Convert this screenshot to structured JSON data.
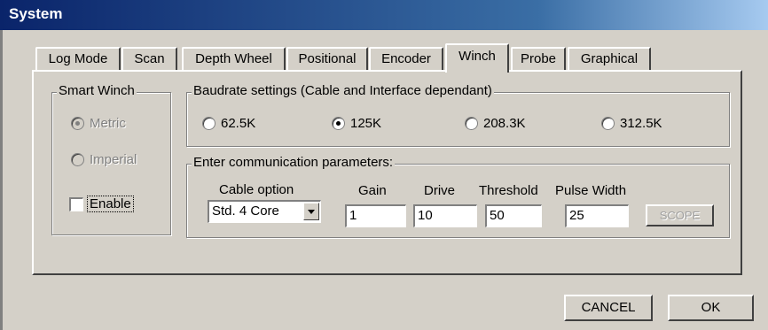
{
  "window": {
    "title": "System"
  },
  "tabs": [
    {
      "label": "Log Mode",
      "active": false
    },
    {
      "label": "Scan",
      "active": false
    },
    {
      "label": "Depth Wheel",
      "active": false
    },
    {
      "label": "Positional",
      "active": false
    },
    {
      "label": "Encoder",
      "active": false
    },
    {
      "label": "Winch",
      "active": true
    },
    {
      "label": "Probe",
      "active": false
    },
    {
      "label": "Graphical",
      "active": false
    }
  ],
  "smart_winch": {
    "title": "Smart Winch",
    "options": [
      {
        "label": "Metric",
        "selected": true,
        "enabled": false
      },
      {
        "label": "Imperial",
        "selected": false,
        "enabled": false
      }
    ],
    "enable": {
      "label": "Enable",
      "checked": false
    }
  },
  "baudrate": {
    "title": "Baudrate settings (Cable and Interface dependant)",
    "options": [
      {
        "label": "62.5K",
        "selected": false
      },
      {
        "label": "125K",
        "selected": true
      },
      {
        "label": "208.3K",
        "selected": false
      },
      {
        "label": "312.5K",
        "selected": false
      }
    ]
  },
  "comm": {
    "title": "Enter communication parameters:",
    "cable_option": {
      "label": "Cable option",
      "value": "Std. 4 Core"
    },
    "gain": {
      "label": "Gain",
      "value": "1"
    },
    "drive": {
      "label": "Drive",
      "value": "10"
    },
    "threshold": {
      "label": "Threshold",
      "value": "50"
    },
    "pulse_width": {
      "label": "Pulse Width",
      "value": "25"
    },
    "scope_label": "SCOPE"
  },
  "buttons": {
    "cancel": "CANCEL",
    "ok": "OK"
  }
}
